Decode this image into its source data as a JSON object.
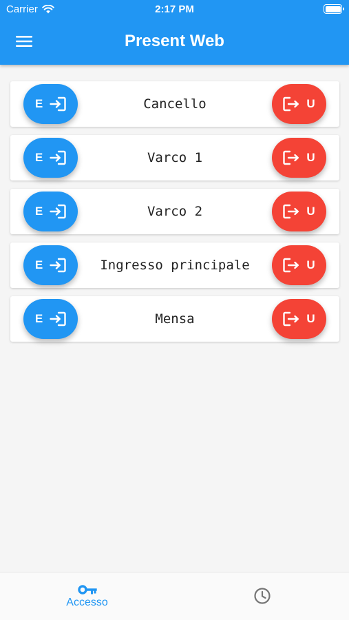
{
  "status_bar": {
    "carrier": "Carrier",
    "time": "2:17 PM"
  },
  "app_bar": {
    "title": "Present Web",
    "menu_icon": "menu-icon"
  },
  "colors": {
    "primary": "#2196f3",
    "exit": "#f44336",
    "background": "#f5f5f5"
  },
  "gates": [
    {
      "name": "Cancello",
      "enter_label": "E",
      "exit_label": "U"
    },
    {
      "name": "Varco 1",
      "enter_label": "E",
      "exit_label": "U"
    },
    {
      "name": "Varco 2",
      "enter_label": "E",
      "exit_label": "U"
    },
    {
      "name": "Ingresso principale",
      "enter_label": "E",
      "exit_label": "U"
    },
    {
      "name": "Mensa",
      "enter_label": "E",
      "exit_label": "U"
    }
  ],
  "bottom_nav": {
    "items": [
      {
        "label": "Accesso",
        "icon": "key-icon",
        "active": true
      },
      {
        "label": "",
        "icon": "clock-icon",
        "active": false
      }
    ]
  }
}
